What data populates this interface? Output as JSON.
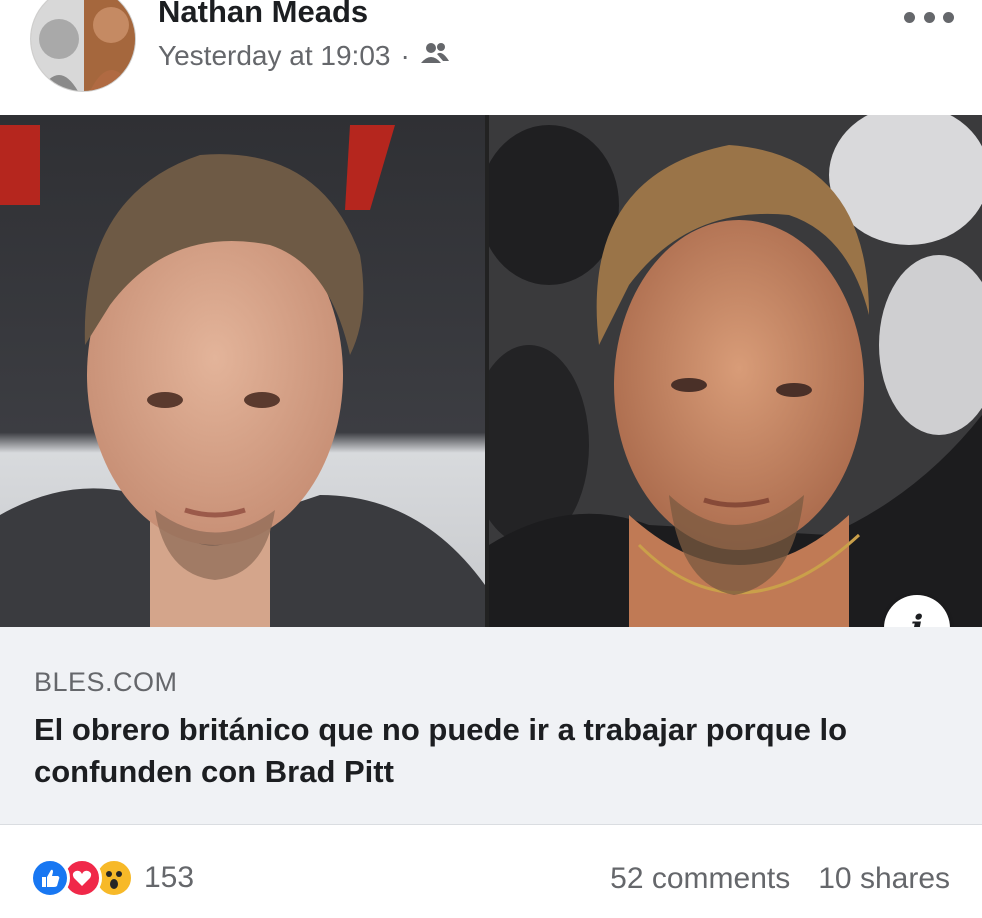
{
  "post": {
    "author": "Nathan Meads",
    "timestamp": "Yesterday at 19:03",
    "separator": "·",
    "audience_icon": "friends-icon",
    "more_icon": "more-dots-icon"
  },
  "link": {
    "domain": "BLES.COM",
    "headline": "El obrero británico que no puede ir a trabajar porque lo confunden con Brad Pitt",
    "info_label": "i"
  },
  "engagement": {
    "reaction_icons": [
      "like-reaction-icon",
      "love-reaction-icon",
      "wow-reaction-icon"
    ],
    "reaction_count": "153",
    "comments": "52 comments",
    "shares": "10 shares"
  },
  "colors": {
    "like": "#1877f2",
    "love": "#f02849",
    "wow": "#f7b928",
    "secondary_text": "#65676b",
    "preview_bg": "#f0f2f5"
  }
}
